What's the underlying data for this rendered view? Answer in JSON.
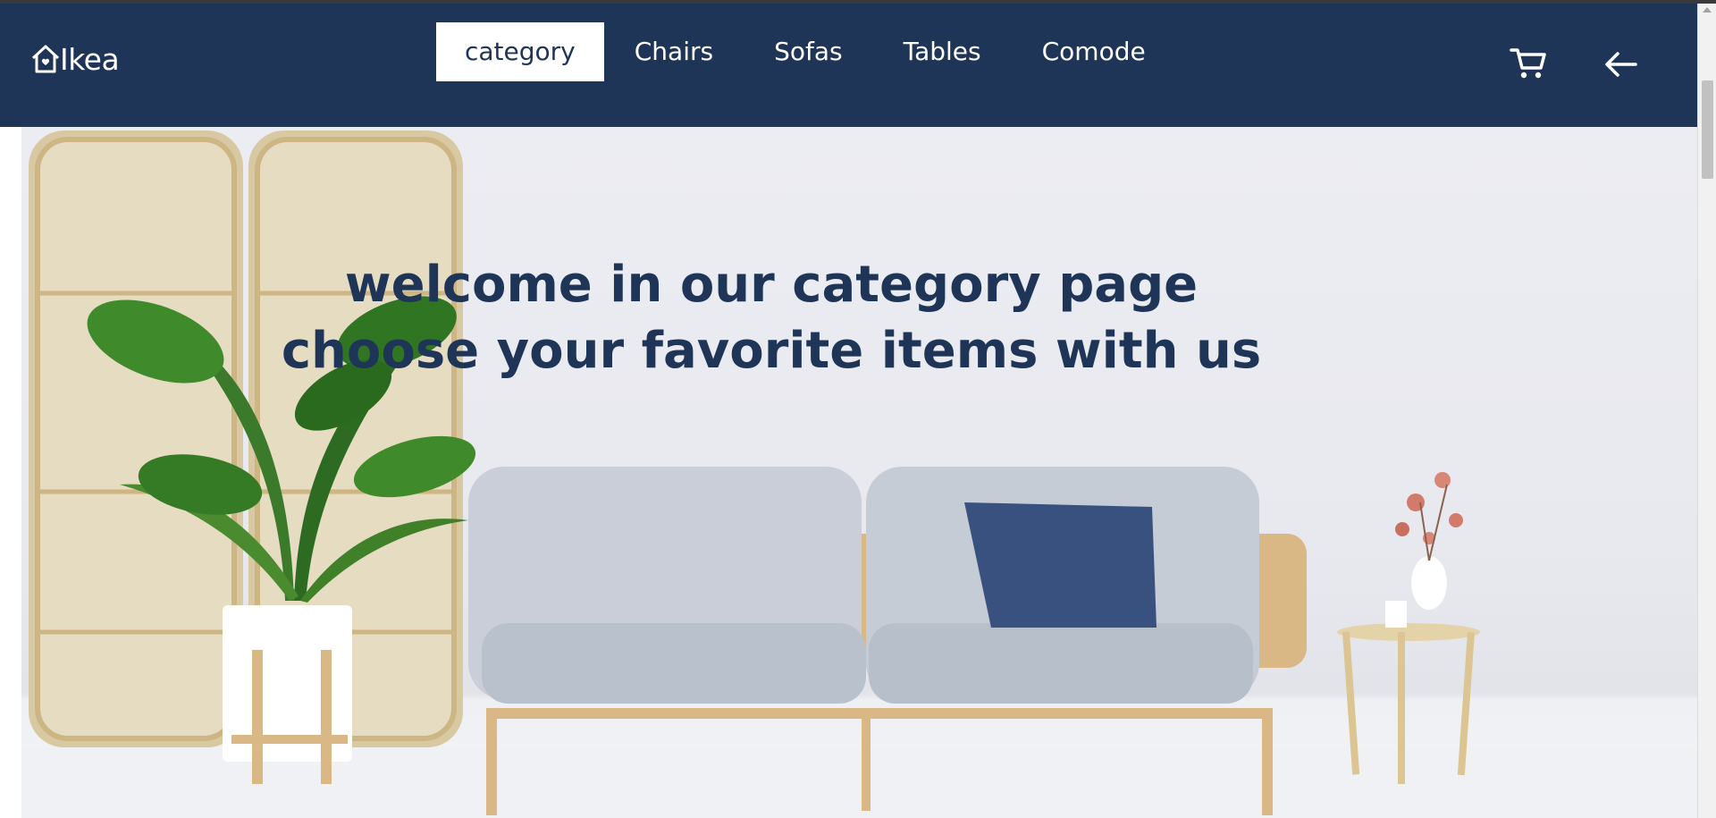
{
  "brand": {
    "name": "Ikea",
    "icon": "home-heart-icon"
  },
  "nav": {
    "items": [
      {
        "label": "category",
        "active": true
      },
      {
        "label": "Chairs",
        "active": false
      },
      {
        "label": "Sofas",
        "active": false
      },
      {
        "label": "Tables",
        "active": false
      },
      {
        "label": "Comode",
        "active": false
      }
    ]
  },
  "actions": {
    "cart_icon": "cart-icon",
    "back_icon": "arrow-left-icon"
  },
  "hero": {
    "line1": "welcome in our category page",
    "line2": "choose your favorite items with us"
  },
  "colors": {
    "navbar": "#1f3557",
    "text_dark": "#1f3557",
    "active_tab_bg": "#ffffff"
  }
}
